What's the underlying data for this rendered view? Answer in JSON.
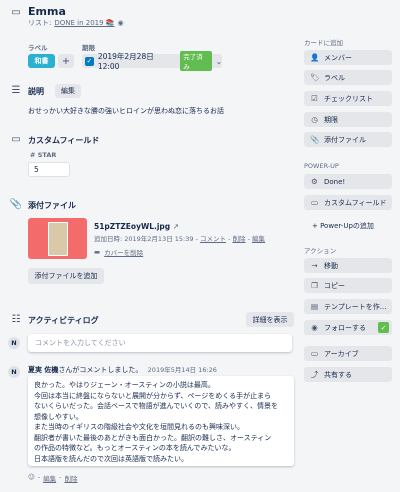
{
  "card": {
    "title": "Emma",
    "list_prefix": "リスト:",
    "list_name": "DONE in 2019 📚"
  },
  "labels": {
    "heading": "ラベル",
    "items": [
      "和書"
    ],
    "add_label": "+",
    "color": "#2ab0d1"
  },
  "due": {
    "heading": "期限",
    "date": "2019年2月28日 12:00",
    "badge": "完了済み",
    "badge_color": "#61bd4f"
  },
  "description": {
    "heading": "説明",
    "edit_label": "編集",
    "text": "おせっかい大好きな勝の強いヒロインが思わぬ恋に落ちるお話"
  },
  "custom_fields": {
    "heading": "カスタムフィールド",
    "star_label": "STAR",
    "star_value": "5"
  },
  "attachments": {
    "heading": "添付ファイル",
    "file_name": "51pZTZEoyWL.jpg",
    "added_text": "追加日時: 2019年2月13日 15:39 -",
    "comment_link": "コメント",
    "delete_link": "削除",
    "edit_link": "編集",
    "sep": "-",
    "remove_cover": "カバーを削除",
    "add_button": "添付ファイルを追加"
  },
  "activity": {
    "heading": "アクティビティログ",
    "details_button": "詳細を表示",
    "input_placeholder": "コメントを入力してください",
    "avatar_initial": "N",
    "author": "夏実 佐機",
    "author_suffix": "さんがコメントしました。",
    "timestamp": "2019年5月14日 16:26",
    "comment_lines": [
      "良かった。やはりジェーン・オースティンの小説は最高。",
      "今回は本当に終盤にならないと展開が分からず、ページをめくる手が止まら",
      "ないくらいだった。会話ベースで物語が進んでいくので、読みやすく、情景を",
      "想像しやすい。",
      "また当時のイギリスの階級社会や文化を垣間見れるのも興味深い。",
      "翻訳者が書いた最後のあとがきも面白かった。翻訳の難しさ、オースティン",
      "の作品の特徴など。もっとオースティンの本を読んでみたいな。",
      "日本語版を読んだので次回は英語版で読みたい。"
    ],
    "comment_actions": {
      "edit": "編集",
      "delete": "削除",
      "sep": "-"
    }
  },
  "sidebar": {
    "add_to_card_title": "カードに追加",
    "add_items": [
      {
        "icon": "person-icon",
        "glyph": "👤",
        "label": "メンバー"
      },
      {
        "icon": "label-icon",
        "glyph": "🏷",
        "label": "ラベル"
      },
      {
        "icon": "checklist-icon",
        "glyph": "☑",
        "label": "チェックリスト"
      },
      {
        "icon": "clock-icon",
        "glyph": "◷",
        "label": "期限"
      },
      {
        "icon": "paperclip-icon",
        "glyph": "📎",
        "label": "添付ファイル"
      }
    ],
    "powerup_title": "POWER-UP",
    "powerup_items": [
      {
        "icon": "gear-icon",
        "glyph": "⚙",
        "label": "Done!"
      },
      {
        "icon": "custom-field-icon",
        "glyph": "▭",
        "label": "カスタムフィールド"
      }
    ],
    "add_powerup_label": "+ Power-Upの追加",
    "actions_title": "アクション",
    "action_items": [
      {
        "icon": "arrow-right-icon",
        "glyph": "→",
        "label": "移動"
      },
      {
        "icon": "copy-icon",
        "glyph": "❐",
        "label": "コピー"
      },
      {
        "icon": "template-icon",
        "glyph": "▤",
        "label": "テンプレートを作..."
      },
      {
        "icon": "eye-icon",
        "glyph": "◉",
        "label": "フォローする"
      },
      {
        "icon": "archive-icon",
        "glyph": "▭",
        "label": "アーカイブ"
      },
      {
        "icon": "share-icon",
        "glyph": "⤴",
        "label": "共有する"
      }
    ]
  }
}
